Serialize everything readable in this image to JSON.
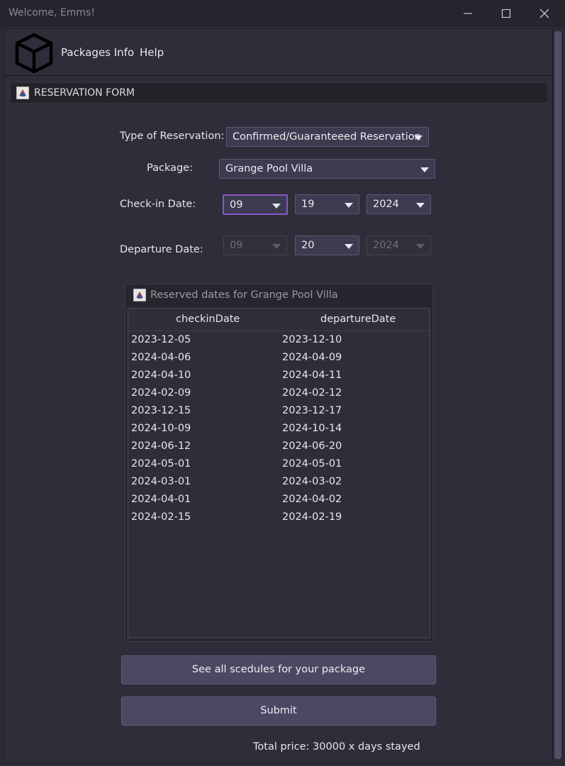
{
  "window": {
    "title": "Welcome, Emms!"
  },
  "menu": {
    "items": [
      "Packages Info",
      "Help"
    ]
  },
  "form": {
    "header": "RESERVATION FORM",
    "type_label": "Type of Reservation:",
    "type_value": "Confirmed/Guaranteeed Reservation",
    "package_label": "Package:",
    "package_value": "Grange Pool Villa",
    "checkin_label": "Check-in Date:",
    "checkin_month": "09",
    "checkin_day": "19",
    "checkin_year": "2024",
    "departure_label": "Departure Date:",
    "departure_month": "09",
    "departure_day": "20",
    "departure_year": "2024"
  },
  "reserved": {
    "title": "Reserved dates for Grange Pool Villa",
    "columns": [
      "checkinDate",
      "departureDate"
    ],
    "rows": [
      [
        "2023-12-05",
        "2023-12-10"
      ],
      [
        "2024-04-06",
        "2024-04-09"
      ],
      [
        "2024-04-10",
        "2024-04-11"
      ],
      [
        "2024-02-09",
        "2024-02-12"
      ],
      [
        "2023-12-15",
        "2023-12-17"
      ],
      [
        "2024-10-09",
        "2024-10-14"
      ],
      [
        "2024-06-12",
        "2024-06-20"
      ],
      [
        "2024-05-01",
        "2024-05-01"
      ],
      [
        "2024-03-01",
        "2024-03-02"
      ],
      [
        "2024-04-01",
        "2024-04-02"
      ],
      [
        "2024-02-15",
        "2024-02-19"
      ]
    ]
  },
  "buttons": {
    "schedules": "See all scedules for your package",
    "submit": "Submit"
  },
  "total": "Total price: 30000 x days stayed",
  "colors": {
    "accent_focus": "#8b55c9",
    "button_bg": "#4a4862",
    "background": "#2e2d39"
  }
}
